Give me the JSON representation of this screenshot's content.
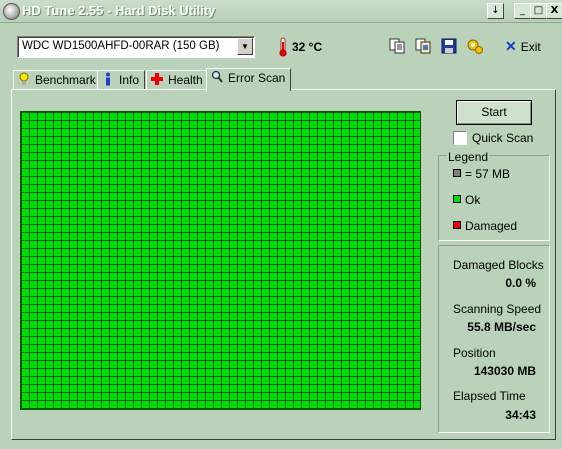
{
  "window": {
    "title": "HD Tune 2.55 - Hard Disk Utility",
    "minimize_glyph": "_",
    "maximize_glyph": "□",
    "close_glyph": "X",
    "dropdown_glyph": "↓"
  },
  "toolbar": {
    "drive": "WDC WD1500AHFD-00RAR (150 GB)",
    "temperature": "32 °C",
    "exit_label": "Exit",
    "icons": [
      "copy-text-icon",
      "copy-screenshot-icon",
      "save-icon",
      "options-icon",
      "exit-icon"
    ]
  },
  "tabs": [
    {
      "label": "Benchmark",
      "icon": "benchmark-icon"
    },
    {
      "label": "Info",
      "icon": "info-icon"
    },
    {
      "label": "Health",
      "icon": "health-icon"
    },
    {
      "label": "Error Scan",
      "icon": "error-scan-icon",
      "active": true
    }
  ],
  "scan": {
    "start_label": "Start",
    "quick_scan_label": "Quick Scan",
    "quick_scan_checked": false,
    "legend": {
      "title": "Legend",
      "items": [
        {
          "label": "= 57 MB",
          "color": "#808080"
        },
        {
          "label": "Ok",
          "color": "#00dd00"
        },
        {
          "label": "Damaged",
          "color": "#ee0000"
        }
      ]
    },
    "block_color": "#00dd00",
    "stats": {
      "damaged_label": "Damaged Blocks",
      "damaged_value": "0.0 %",
      "speed_label": "Scanning Speed",
      "speed_value": "55.8 MB/sec",
      "position_label": "Position",
      "position_value": "143030 MB",
      "elapsed_label": "Elapsed Time",
      "elapsed_value": "34:43"
    }
  }
}
